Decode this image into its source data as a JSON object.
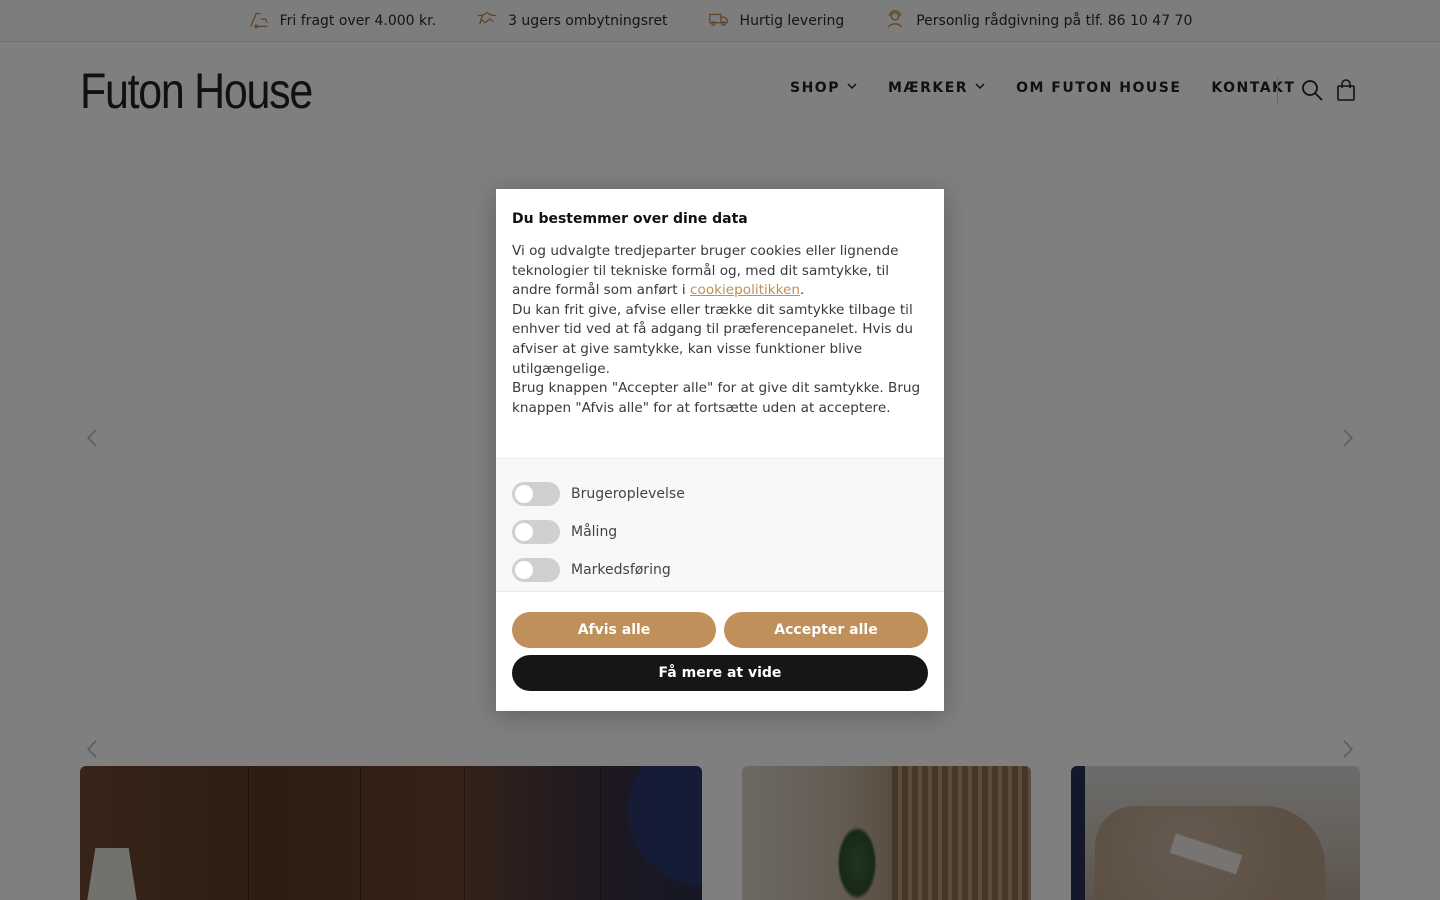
{
  "topbar": {
    "items": [
      {
        "icon": "shipping-hand-icon",
        "label": "Fri fragt over 4.000 kr."
      },
      {
        "icon": "handshake-icon",
        "label": "3 ugers ombytningsret"
      },
      {
        "icon": "delivery-truck-icon",
        "label": "Hurtig levering"
      },
      {
        "icon": "support-agent-icon",
        "label": "Personlig rådgivning på tlf. 86 10 47 70"
      }
    ],
    "icon_color": "#bf8a54"
  },
  "header": {
    "logo": "Futon House",
    "nav": [
      {
        "label": "SHOP",
        "has_dropdown": true
      },
      {
        "label": "MÆRKER",
        "has_dropdown": true
      },
      {
        "label": "OM FUTON HOUSE",
        "has_dropdown": false
      },
      {
        "label": "KONTAKT",
        "has_dropdown": false
      }
    ],
    "icons": [
      "search-icon",
      "cart-icon"
    ]
  },
  "cookie_dialog": {
    "title": "Du bestemmer over dine data",
    "text_1": "Vi og udvalgte tredjeparter bruger cookies eller lignende teknologier til tekniske formål og, med dit samtykke, til andre formål som anført i ",
    "link": "cookiepolitikken",
    "text_1_end": ".",
    "text_2": "Du kan frit give, afvise eller trække dit samtykke tilbage til enhver tid ved at få adgang til præferencepanelet. Hvis du afviser at give samtykke, kan visse funktioner blive utilgængelige.",
    "text_3": "Brug knappen \"Accepter alle\" for at give dit samtykke. Brug knappen \"Afvis alle\" for at fortsætte uden at acceptere.",
    "toggles": [
      {
        "label": "Brugeroplevelse",
        "on": false
      },
      {
        "label": "Måling",
        "on": false
      },
      {
        "label": "Markedsføring",
        "on": false
      }
    ],
    "buttons": {
      "reject": "Afvis alle",
      "accept": "Accepter alle",
      "learn_more": "Få mere at vide"
    },
    "accent_color": "#bf9059",
    "dark_button_color": "#161616"
  }
}
